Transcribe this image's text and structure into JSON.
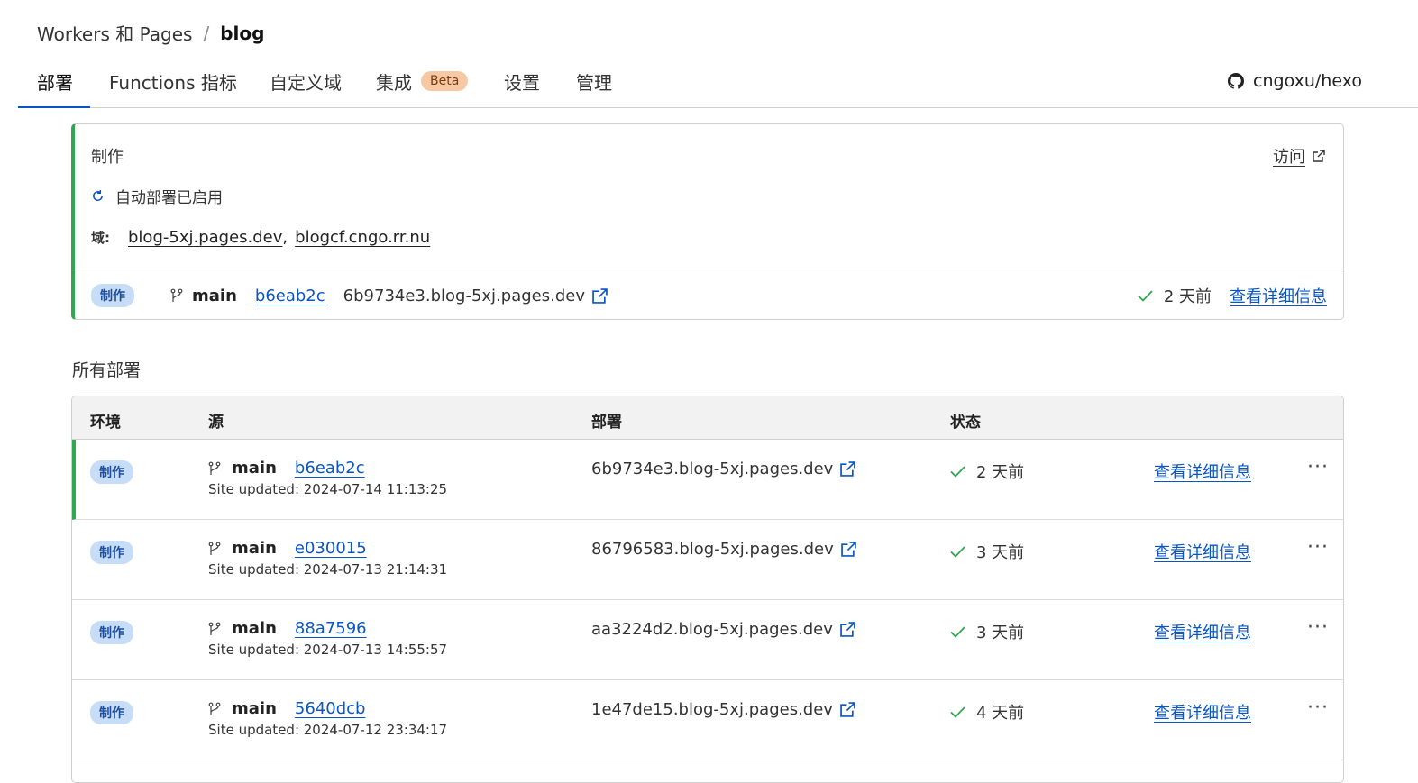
{
  "breadcrumb": {
    "parent": "Workers 和 Pages",
    "separator": "/",
    "current": "blog"
  },
  "tabs": [
    {
      "label": "部署"
    },
    {
      "label": "Functions 指标"
    },
    {
      "label": "自定义域"
    },
    {
      "label": "集成",
      "badge": "Beta"
    },
    {
      "label": "设置"
    },
    {
      "label": "管理"
    }
  ],
  "repo": "cngoxu/hexo",
  "production": {
    "title": "制作",
    "visit_label": "访问",
    "auto_deploy": "自动部署已启用",
    "domains_label": "域:",
    "domains": [
      "blog-5xj.pages.dev",
      "blogcf.cngo.rr.nu"
    ],
    "domain_sep": ",",
    "row": {
      "env": "制作",
      "branch": "main",
      "commit": "b6eab2c",
      "url": "6b9734e3.blog-5xj.pages.dev",
      "status": "2 天前",
      "details": "查看详细信息"
    }
  },
  "all_deployments": {
    "title": "所有部署",
    "headers": {
      "env": "环境",
      "source": "源",
      "deploy": "部署",
      "status": "状态"
    },
    "rows": [
      {
        "env": "制作",
        "branch": "main",
        "commit": "b6eab2c",
        "updated": "Site updated: 2024-07-14 11:13:25",
        "url": "6b9734e3.blog-5xj.pages.dev",
        "status": "2 天前",
        "details": "查看详细信息",
        "more": "···"
      },
      {
        "env": "制作",
        "branch": "main",
        "commit": "e030015",
        "updated": "Site updated: 2024-07-13 21:14:31",
        "url": "86796583.blog-5xj.pages.dev",
        "status": "3 天前",
        "details": "查看详细信息",
        "more": "···"
      },
      {
        "env": "制作",
        "branch": "main",
        "commit": "88a7596",
        "updated": "Site updated: 2024-07-13 14:55:57",
        "url": "aa3224d2.blog-5xj.pages.dev",
        "status": "3 天前",
        "details": "查看详细信息",
        "more": "···"
      },
      {
        "env": "制作",
        "branch": "main",
        "commit": "5640dcb",
        "updated": "Site updated: 2024-07-12 23:34:17",
        "url": "1e47de15.blog-5xj.pages.dev",
        "status": "4 天前",
        "details": "查看详细信息",
        "more": "···"
      }
    ]
  },
  "colors": {
    "accent": "#0a55c4",
    "success": "#2fa84f",
    "badge_bg": "#c7dcf7",
    "beta_bg": "#f6c9a4"
  }
}
